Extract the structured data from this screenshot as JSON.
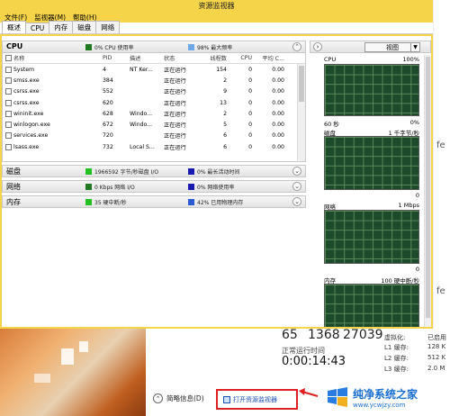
{
  "window": {
    "title": "资源监视器"
  },
  "menu": [
    "文件(F)",
    "监视器(M)",
    "帮助(H)"
  ],
  "tabs": [
    "概述",
    "CPU",
    "内存",
    "磁盘",
    "网络"
  ],
  "cpu_section": {
    "title": "CPU",
    "ind1": "0% CPU 使用率",
    "ind2": "98% 最大频率",
    "ind1_color": "#1f7a1f",
    "ind2_color": "#6fa8e8",
    "columns": [
      "名称",
      "PID",
      "描述",
      "状态",
      "线程数",
      "CPU",
      "平均 C..."
    ],
    "rows": [
      {
        "name": "System",
        "pid": "4",
        "desc": "NT Ker...",
        "status": "正在运行",
        "threads": "154",
        "cpu": "0",
        "avg": "0.00"
      },
      {
        "name": "smss.exe",
        "pid": "384",
        "desc": "",
        "status": "正在运行",
        "threads": "2",
        "cpu": "0",
        "avg": "0.00"
      },
      {
        "name": "csrss.exe",
        "pid": "552",
        "desc": "",
        "status": "正在运行",
        "threads": "9",
        "cpu": "0",
        "avg": "0.00"
      },
      {
        "name": "csrss.exe",
        "pid": "620",
        "desc": "",
        "status": "正在运行",
        "threads": "13",
        "cpu": "0",
        "avg": "0.00"
      },
      {
        "name": "wininit.exe",
        "pid": "628",
        "desc": "Windo...",
        "status": "正在运行",
        "threads": "2",
        "cpu": "0",
        "avg": "0.00"
      },
      {
        "name": "winlogon.exe",
        "pid": "672",
        "desc": "Windo...",
        "status": "正在运行",
        "threads": "5",
        "cpu": "0",
        "avg": "0.00"
      },
      {
        "name": "services.exe",
        "pid": "720",
        "desc": "",
        "status": "正在运行",
        "threads": "6",
        "cpu": "0",
        "avg": "0.00"
      },
      {
        "name": "lsass.exe",
        "pid": "732",
        "desc": "Local S...",
        "status": "正在运行",
        "threads": "6",
        "cpu": "0",
        "avg": "0.00"
      }
    ]
  },
  "disk_section": {
    "title": "磁盘",
    "ind1": "1966592 字节/秒磁盘 I/O",
    "ind2": "0% 最长活动时间",
    "ind1_color": "#22c022",
    "ind2_color": "#1a1ab0"
  },
  "net_section": {
    "title": "网络",
    "ind1": "0 Kbps 网络 I/O",
    "ind2": "0% 网络使用率",
    "ind1_color": "#1f7a1f",
    "ind2_color": "#1a1ab0"
  },
  "mem_section": {
    "title": "内存",
    "ind1": "35 硬中断/秒",
    "ind2": "42% 已用物理内存",
    "ind1_color": "#22c022",
    "ind2_color": "#2a5ad0"
  },
  "right_panel": {
    "view_label": "视图",
    "graphs": [
      {
        "name": "CPU",
        "max": "100%",
        "foot_left": "60 秒",
        "foot_right": "0%"
      },
      {
        "name": "磁盘",
        "max": "1 千字节/秒",
        "foot_left": "",
        "foot_right": "0"
      },
      {
        "name": "网络",
        "max": "1 Mbps",
        "foot_left": "",
        "foot_right": "0"
      },
      {
        "name": "内存",
        "max": "100 硬中断/秒",
        "foot_left": "",
        "foot_right": ""
      }
    ]
  },
  "background": {
    "n1": "65",
    "n2": "1368",
    "n3": "27039",
    "uptime_label": "正常运行时间",
    "uptime": "0:00:14:43",
    "cache_rows": [
      {
        "label": "虚拟化:",
        "value": "已启用"
      },
      {
        "label": "L1 缓存:",
        "value": "128 K"
      },
      {
        "label": "L2 缓存:",
        "value": "512 K"
      },
      {
        "label": "L3 缓存:",
        "value": "2.0 M"
      }
    ],
    "right_glyphs": [
      "fe",
      "fe"
    ],
    "brief_info": "简略信息(D)",
    "open_monitor": "打开资源监视器",
    "logo_name": "纯净系统之家",
    "logo_url": "www.ycwjzy.com"
  }
}
